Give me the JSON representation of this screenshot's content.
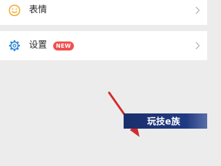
{
  "menu": {
    "emoji_item": {
      "label": "表情",
      "icon": "smiley-icon"
    },
    "settings_item": {
      "label": "设置",
      "icon": "gear-icon",
      "badge": "NEW"
    }
  },
  "watermark": {
    "text": "玩技e族"
  },
  "colors": {
    "accent_orange": "#f5a623",
    "accent_blue": "#2f86d6",
    "badge_red": "#f04f4f",
    "arrow_red": "#d42a2a",
    "background": "#ececec"
  }
}
